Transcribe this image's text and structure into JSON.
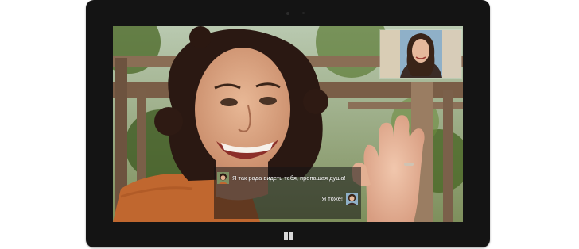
{
  "call": {
    "messages": [
      {
        "from": "remote",
        "text": "Я так рада видеть тебя, пропащая душа!"
      },
      {
        "from": "self",
        "text": "Я тоже!"
      }
    ]
  },
  "device": {
    "start_button_icon": "windows-logo-icon"
  },
  "colors": {
    "bezel": "#141414",
    "chat_overlay": "rgba(20,20,20,0.55)"
  }
}
